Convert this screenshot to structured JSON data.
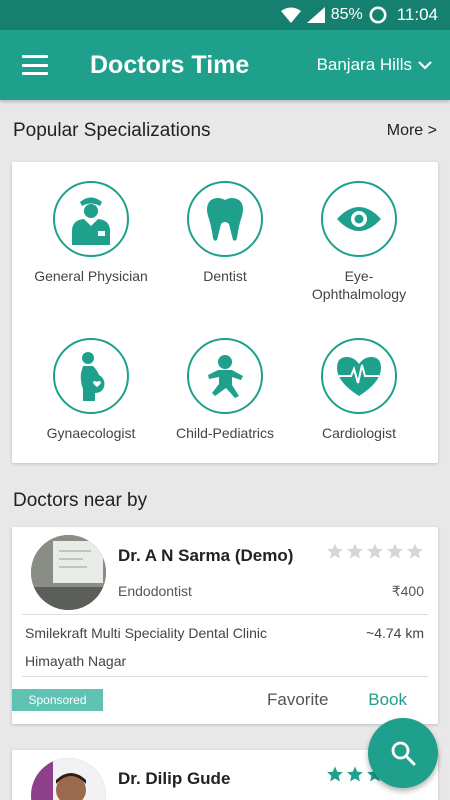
{
  "status_bar": {
    "battery": "85%",
    "time": "11:04"
  },
  "app_bar": {
    "title": "Doctors Time",
    "location": "Banjara Hills"
  },
  "specializations": {
    "title": "Popular Specializations",
    "more": "More >",
    "items": [
      {
        "label": "General Physician",
        "icon": "doctor-icon"
      },
      {
        "label": "Dentist",
        "icon": "tooth-icon"
      },
      {
        "label": "Eye-\nOphthalmology",
        "icon": "eye-icon"
      },
      {
        "label": "Gynaecologist",
        "icon": "pregnant-woman-icon"
      },
      {
        "label": "Child-Pediatrics",
        "icon": "baby-icon"
      },
      {
        "label": "Cardiologist",
        "icon": "heart-pulse-icon"
      }
    ]
  },
  "doctors": {
    "title": "Doctors near by",
    "list": [
      {
        "name": "Dr. A N Sarma (Demo)",
        "specialty": "Endodontist",
        "fee": "₹400",
        "clinic": "Smilekraft Multi Speciality Dental Clinic",
        "distance": "~4.74 km",
        "area": "Himayath Nagar",
        "badge": "Sponsored",
        "favorite": "Favorite",
        "book": "Book",
        "rating": 0
      },
      {
        "name": "Dr. Dilip Gude",
        "rating": 3
      }
    ]
  },
  "colors": {
    "primary": "#1ea08c",
    "primary_dark": "#15806f",
    "badge": "#5fc2b3",
    "star_empty": "#d6d6d6"
  },
  "fab": {
    "icon": "search-icon"
  }
}
